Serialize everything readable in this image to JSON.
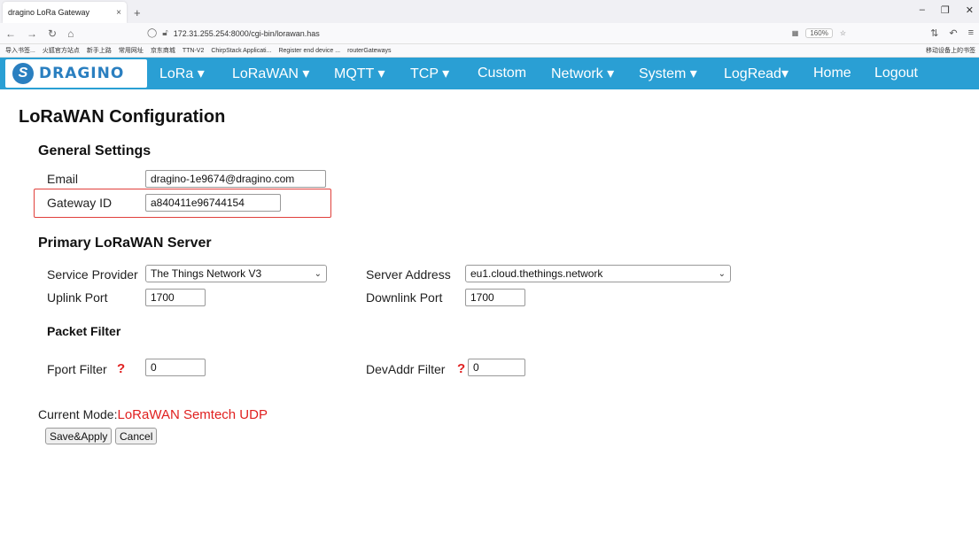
{
  "browser": {
    "tab_title": "dragino LoRa Gateway",
    "tab_close": "×",
    "new_tab": "+",
    "url": "172.31.255.254:8000/cgi-bin/lorawan.has",
    "zoom": "160%",
    "bookmarks": [
      "导入书签...",
      "火狐官方站点",
      "新手上路",
      "常用网址",
      "京东商城",
      "TTN-V2",
      "ChirpStack Applicati...",
      "Register end device ...",
      "routerGateways"
    ],
    "bookmarks_right": "移动设备上的书签"
  },
  "app": {
    "logo_text": "DRAGINO",
    "menu": [
      "LoRa ▾",
      "LoRaWAN ▾",
      "MQTT ▾",
      "TCP ▾",
      "Custom",
      "Network ▾",
      "System ▾",
      "LogRead▾",
      "Home",
      "Logout"
    ],
    "nav_color": "#2a9fd4"
  },
  "page": {
    "title": "LoRaWAN Configuration",
    "general": {
      "heading": "General Settings",
      "email_label": "Email",
      "email_value": "dragino-1e9674@dragino.com",
      "gateway_label": "Gateway ID",
      "gateway_value": "a840411e96744154"
    },
    "primary": {
      "heading": "Primary LoRaWAN Server",
      "provider_label": "Service Provider",
      "provider_value": "The Things Network V3",
      "server_label": "Server Address",
      "server_value": "eu1.cloud.thethings.network",
      "uplink_label": "Uplink Port",
      "uplink_value": "1700",
      "downlink_label": "Downlink Port",
      "downlink_value": "1700"
    },
    "filter": {
      "heading": "Packet Filter",
      "fport_label": "Fport Filter",
      "fport_value": "0",
      "devaddr_label": "DevAddr Filter",
      "devaddr_value": "0",
      "help": "?"
    },
    "mode": {
      "label": "Current Mode:",
      "value": "LoRaWAN Semtech UDP"
    },
    "buttons": {
      "save": "Save&Apply",
      "cancel": "Cancel"
    }
  }
}
